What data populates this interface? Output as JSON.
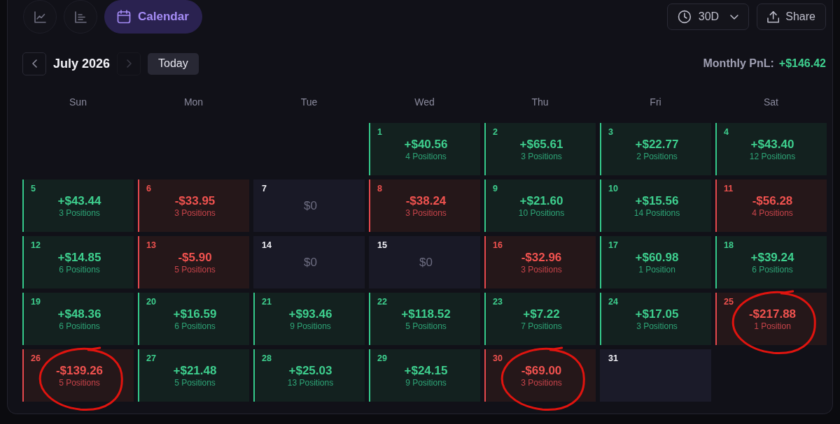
{
  "toolbar": {
    "view_tabs": [
      {
        "kind": "line-chart",
        "selected": false
      },
      {
        "kind": "bar-list",
        "selected": false
      },
      {
        "kind": "calendar",
        "label": "Calendar",
        "selected": true
      }
    ],
    "range_dropdown": {
      "value": "30D"
    },
    "share_button": {
      "label": "Share"
    }
  },
  "month_nav": {
    "prev_button": {
      "disabled": false
    },
    "month": "July 2026",
    "next_button": {
      "disabled": true
    },
    "today_button": {
      "label": "Today"
    }
  },
  "monthly_pnl": {
    "label": "Monthly PnL:",
    "value": "+$146.42"
  },
  "calendar": {
    "weekdays": [
      "Sun",
      "Mon",
      "Tue",
      "Wed",
      "Thu",
      "Fri",
      "Sat"
    ],
    "cells": [
      {
        "kind": "blank"
      },
      {
        "kind": "blank"
      },
      {
        "kind": "blank"
      },
      {
        "kind": "gain",
        "day": "1",
        "pnl": "+$40.56",
        "positions": "4 Positions",
        "circled": false
      },
      {
        "kind": "gain",
        "day": "2",
        "pnl": "+$65.61",
        "positions": "3 Positions",
        "circled": false
      },
      {
        "kind": "gain",
        "day": "3",
        "pnl": "+$22.77",
        "positions": "2 Positions",
        "circled": false
      },
      {
        "kind": "gain",
        "day": "4",
        "pnl": "+$43.40",
        "positions": "12 Positions",
        "circled": false
      },
      {
        "kind": "gain",
        "day": "5",
        "pnl": "+$43.44",
        "positions": "3 Positions",
        "circled": false
      },
      {
        "kind": "loss",
        "day": "6",
        "pnl": "-$33.95",
        "positions": "3 Positions",
        "circled": false
      },
      {
        "kind": "flat",
        "day": "7",
        "pnl": "$0",
        "circled": false
      },
      {
        "kind": "loss",
        "day": "8",
        "pnl": "-$38.24",
        "positions": "3 Positions",
        "circled": false
      },
      {
        "kind": "gain",
        "day": "9",
        "pnl": "+$21.60",
        "positions": "10 Positions",
        "circled": false
      },
      {
        "kind": "gain",
        "day": "10",
        "pnl": "+$15.56",
        "positions": "14 Positions",
        "circled": false
      },
      {
        "kind": "loss",
        "day": "11",
        "pnl": "-$56.28",
        "positions": "4 Positions",
        "circled": false
      },
      {
        "kind": "gain",
        "day": "12",
        "pnl": "+$14.85",
        "positions": "6 Positions",
        "circled": false
      },
      {
        "kind": "loss",
        "day": "13",
        "pnl": "-$5.90",
        "positions": "5 Positions",
        "circled": false
      },
      {
        "kind": "flat",
        "day": "14",
        "pnl": "$0",
        "circled": false
      },
      {
        "kind": "flat",
        "day": "15",
        "pnl": "$0",
        "circled": false
      },
      {
        "kind": "loss",
        "day": "16",
        "pnl": "-$32.96",
        "positions": "3 Positions",
        "circled": false
      },
      {
        "kind": "gain",
        "day": "17",
        "pnl": "+$60.98",
        "positions": "1 Position",
        "circled": false
      },
      {
        "kind": "gain",
        "day": "18",
        "pnl": "+$39.24",
        "positions": "6 Positions",
        "circled": false
      },
      {
        "kind": "gain",
        "day": "19",
        "pnl": "+$48.36",
        "positions": "6 Positions",
        "circled": false
      },
      {
        "kind": "gain",
        "day": "20",
        "pnl": "+$16.59",
        "positions": "6 Positions",
        "circled": false
      },
      {
        "kind": "gain",
        "day": "21",
        "pnl": "+$93.46",
        "positions": "9 Positions",
        "circled": false
      },
      {
        "kind": "gain",
        "day": "22",
        "pnl": "+$118.52",
        "positions": "5 Positions",
        "circled": false
      },
      {
        "kind": "gain",
        "day": "23",
        "pnl": "+$7.22",
        "positions": "7 Positions",
        "circled": false
      },
      {
        "kind": "gain",
        "day": "24",
        "pnl": "+$17.05",
        "positions": "3 Positions",
        "circled": false
      },
      {
        "kind": "loss",
        "day": "25",
        "pnl": "-$217.88",
        "positions": "1 Position",
        "circled": true
      },
      {
        "kind": "loss",
        "day": "26",
        "pnl": "-$139.26",
        "positions": "5 Positions",
        "circled": true
      },
      {
        "kind": "gain",
        "day": "27",
        "pnl": "+$21.48",
        "positions": "5 Positions",
        "circled": false
      },
      {
        "kind": "gain",
        "day": "28",
        "pnl": "+$25.03",
        "positions": "13 Positions",
        "circled": false
      },
      {
        "kind": "gain",
        "day": "29",
        "pnl": "+$24.15",
        "positions": "9 Positions",
        "circled": false
      },
      {
        "kind": "loss",
        "day": "30",
        "pnl": "-$69.00",
        "positions": "3 Positions",
        "circled": true
      },
      {
        "kind": "no-trades",
        "day": "31",
        "circled": false
      }
    ]
  }
}
